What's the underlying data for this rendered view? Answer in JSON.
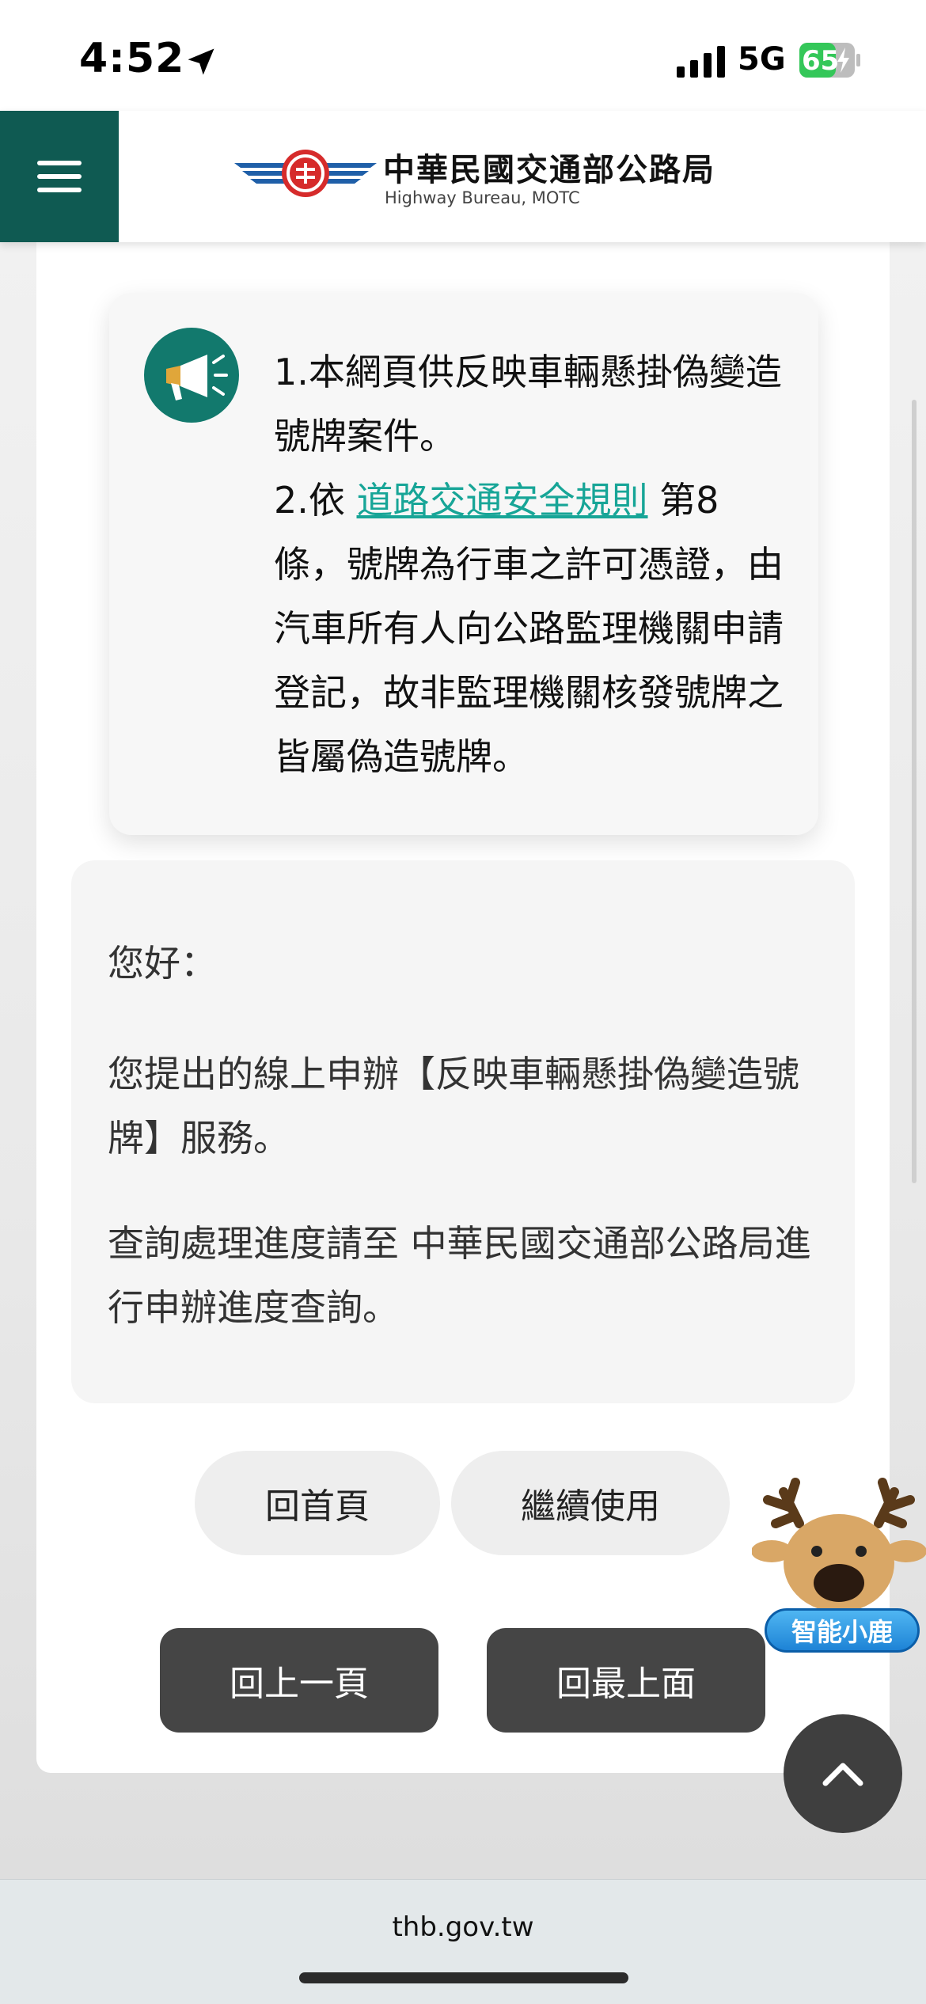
{
  "status_bar": {
    "time": "4:52",
    "network": "5G",
    "battery": "65"
  },
  "header": {
    "org_name": "中華民國交通部公路局",
    "org_subtitle": "Highway Bureau, MOTC"
  },
  "notice": {
    "line1": "1.本網頁供反映車輛懸掛偽變造號牌案件。",
    "line2_prefix": "2.依 ",
    "line2_link": "道路交通安全規則",
    "line2_suffix": " 第8條，號牌為行車之許可憑證，由汽車所有人向公路監理機關申請登記，故非監理機關核發號牌之皆屬偽造號牌。"
  },
  "message": {
    "greeting": "您好：",
    "body": "您提出的線上申辦【反映車輛懸掛偽變造號牌】服務。",
    "query": "查詢處理進度請至 中華民國交通部公路局進行申辦進度查詢。"
  },
  "buttons": {
    "home": "回首頁",
    "continue": "繼續使用",
    "prev_page": "回上一頁",
    "back_to_top": "回最上面"
  },
  "assistant": {
    "label": "智能小鹿"
  },
  "browser": {
    "url": "thb.gov.tw"
  },
  "colors": {
    "brand_green": "#0f5a52",
    "link_teal": "#17a597",
    "dark_button": "#454545",
    "assistant_blue": "#1e83d6"
  }
}
